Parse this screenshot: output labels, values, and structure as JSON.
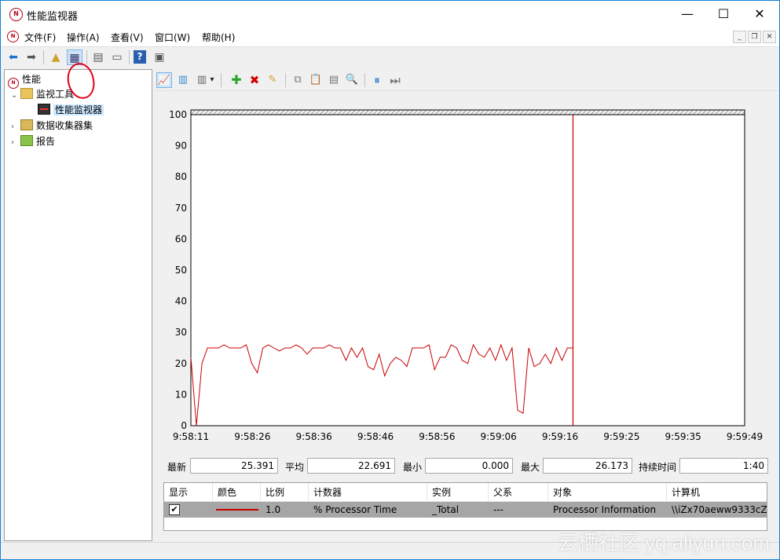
{
  "window": {
    "title": "性能监视器",
    "app_icon_text": "N",
    "min_glyph": "—",
    "max_glyph": "☐",
    "close_glyph": "✕"
  },
  "menu": {
    "items": [
      "文件(F)",
      "操作(A)",
      "查看(V)",
      "窗口(W)",
      "帮助(H)"
    ],
    "mdi_min": "_",
    "mdi_restore": "❐",
    "mdi_close": "✕"
  },
  "toolbar": {
    "back_glyph": "⬅",
    "forward_glyph": "➡",
    "up_glyph": "▲",
    "show_hide_glyph": "▦",
    "export_glyph": "▤",
    "print_glyph": "▭",
    "help_glyph": "?",
    "view_glyph": "▣"
  },
  "tree": {
    "items": [
      {
        "label": "性能",
        "icon": "performance-icon"
      },
      {
        "label": "监视工具",
        "icon": "folder-icon",
        "arrow": "⌄"
      },
      {
        "label": "性能监视器",
        "icon": "monitor-icon"
      },
      {
        "label": "数据收集器集",
        "icon": "data-collector-icon",
        "arrow": "›"
      },
      {
        "label": "报告",
        "icon": "report-icon",
        "arrow": "›"
      }
    ]
  },
  "graph_toolbar": {
    "view_graph": "📈",
    "view_histogram": "▥",
    "change_type": "▾",
    "add": "✚",
    "delete": "✖",
    "highlight": "✎",
    "copy": "⧉",
    "paste": "📋",
    "properties": "▤",
    "zoom": "🔍",
    "freeze": "⏸",
    "update": "⏭",
    "type_dropdown": "▾"
  },
  "stats": {
    "last_label": "最新",
    "last_value": "25.391",
    "avg_label": "平均",
    "avg_value": "22.691",
    "min_label": "最小",
    "min_value": "0.000",
    "max_label": "最大",
    "max_value": "26.173",
    "duration_label": "持续时间",
    "duration_value": "1:40"
  },
  "table": {
    "headers": [
      "显示",
      "颜色",
      "比例",
      "计数器",
      "实例",
      "父系",
      "对象",
      "计算机"
    ],
    "row": {
      "show_check": "✔",
      "scale": "1.0",
      "counter": "% Processor Time",
      "instance": "_Total",
      "parent": "---",
      "object": "Processor Information",
      "computer": "\\\\iZx70aeww9333cZ"
    }
  },
  "watermark": "云栖社区 yq.aliyun.com",
  "colors": {
    "series": "#c80000",
    "annotation_circle": "#e0001b",
    "selection": "#cce8ff"
  },
  "chart_data": {
    "type": "line",
    "title": "",
    "xlabel": "",
    "ylabel": "",
    "ylim": [
      0,
      100
    ],
    "yticks": [
      0,
      10,
      20,
      30,
      40,
      50,
      60,
      70,
      80,
      90,
      100
    ],
    "xticks": [
      "9:58:11",
      "9:58:26",
      "9:58:36",
      "9:58:46",
      "9:58:56",
      "9:59:06",
      "9:59:16",
      "9:59:25",
      "9:59:35",
      "9:59:49"
    ],
    "cursor_sample": 69,
    "total_samples": 100,
    "series": [
      {
        "values": [
          22,
          0,
          20,
          25,
          25,
          25,
          26,
          25,
          25,
          25,
          26,
          20,
          17,
          25,
          26,
          25,
          24,
          25,
          25,
          26,
          25,
          23,
          25,
          25,
          25,
          26,
          25,
          25,
          21,
          25,
          22,
          25,
          19,
          18,
          23,
          16,
          20,
          22,
          21,
          19,
          25,
          25,
          25,
          26,
          18,
          22,
          22,
          26,
          25,
          21,
          20,
          26,
          23,
          22,
          25,
          21,
          26,
          21,
          25,
          5,
          4,
          25,
          19,
          20,
          23,
          20,
          25,
          21,
          25,
          25
        ]
      }
    ]
  }
}
